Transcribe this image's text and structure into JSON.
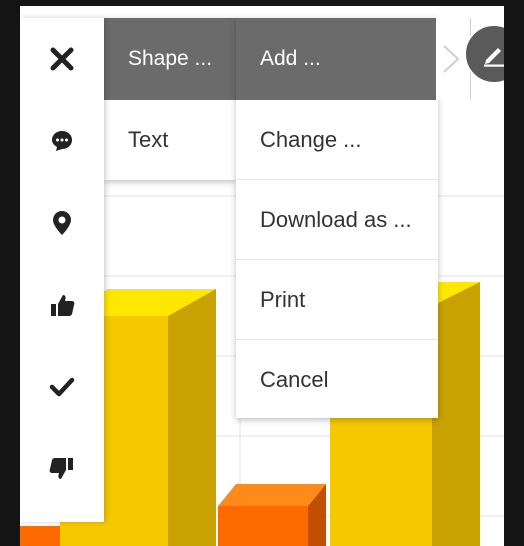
{
  "shape_menu": {
    "header": "Shape ...",
    "items": [
      "Text"
    ]
  },
  "add_menu": {
    "header": "Add ...",
    "items": [
      "Change ...",
      "Download as ...",
      "Print",
      "Cancel"
    ]
  },
  "icons": [
    "close-icon",
    "comment-icon",
    "pin-icon",
    "thumbs-up-icon",
    "checkmark-icon",
    "thumbs-down-icon"
  ],
  "colors": {
    "bar_yellow": "#f2c500",
    "bar_orange": "#ff6a00",
    "menu_header": "#6b6b6b"
  }
}
